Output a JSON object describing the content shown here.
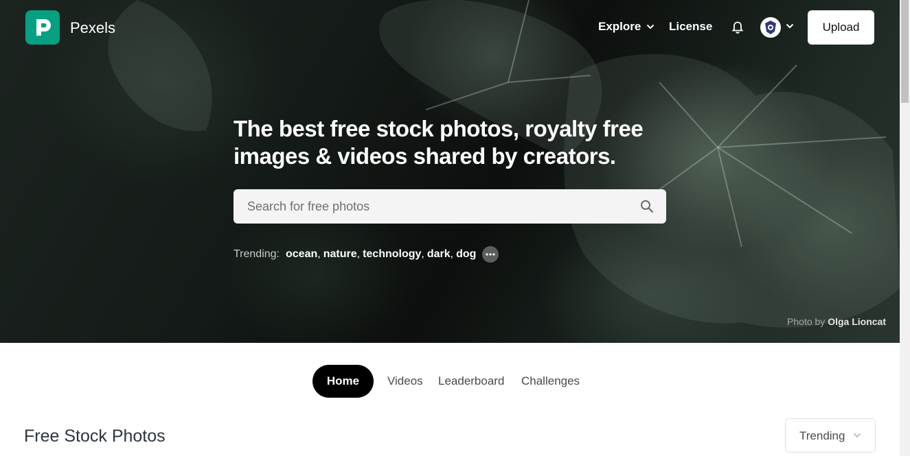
{
  "header": {
    "brand": "Pexels",
    "nav": {
      "explore_label": "Explore",
      "license_label": "License",
      "upload_label": "Upload"
    }
  },
  "hero": {
    "headline_line1": "The best free stock photos, royalty free",
    "headline_line2": "images & videos shared by creators.",
    "search": {
      "placeholder": "Search for free photos"
    },
    "trending": {
      "label": "Trending:",
      "items": [
        "ocean",
        "nature",
        "technology",
        "dark",
        "dog"
      ]
    },
    "credit": {
      "label": "Photo by",
      "author": "Olga Lioncat"
    }
  },
  "tabs": [
    "Home",
    "Videos",
    "Leaderboard",
    "Challenges"
  ],
  "active_tab": "Home",
  "section": {
    "title": "Free Stock Photos",
    "sort_value": "Trending"
  },
  "colors": {
    "brand": "#05a081",
    "active_tab_bg": "#000000"
  },
  "icons": [
    "pexels-logo-icon",
    "chevron-down-icon",
    "bell-icon",
    "avatar-icon",
    "search-icon",
    "more-icon"
  ]
}
